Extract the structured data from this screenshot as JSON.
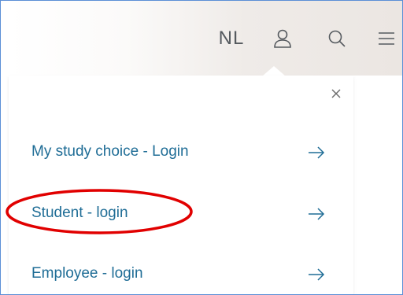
{
  "header": {
    "language_label": "NL",
    "icons": {
      "user": "user-icon",
      "search": "search-icon",
      "menu": "hamburger-menu-icon"
    }
  },
  "login_panel": {
    "close_label": "×",
    "links": [
      {
        "label": "My study choice - Login",
        "icon": "arrow-right-icon"
      },
      {
        "label": "Student - login",
        "icon": "arrow-right-icon",
        "highlighted": true
      },
      {
        "label": "Employee - login",
        "icon": "arrow-right-icon"
      }
    ]
  },
  "colors": {
    "link": "#1f6d96",
    "icon": "#555a5f",
    "header_bg": "#ebe6e2",
    "annotation": "#e10000",
    "frame_border": "#5b8fd6"
  }
}
